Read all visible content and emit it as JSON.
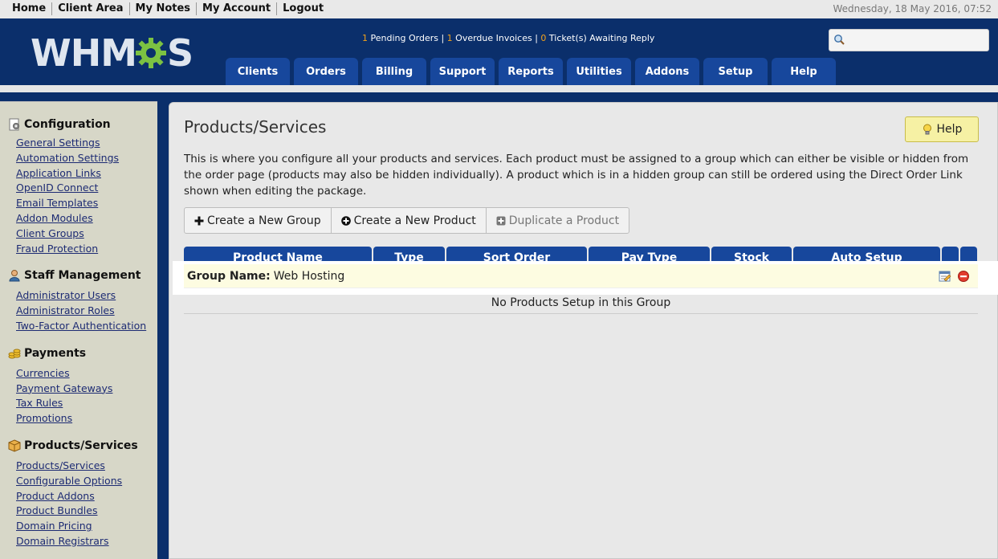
{
  "topbar": {
    "links": [
      "Home",
      "Client Area",
      "My Notes",
      "My Account",
      "Logout"
    ],
    "datetime": "Wednesday, 18 May 2016, 07:52"
  },
  "header": {
    "logo_left": "WHM",
    "logo_right": "S",
    "notices": {
      "pending_count": "1",
      "pending_label": "Pending Orders |",
      "overdue_count": "1",
      "overdue_label": "Overdue Invoices |",
      "tickets_count": "0",
      "tickets_label": "Ticket(s) Awaiting Reply"
    },
    "search_placeholder": "",
    "tabs": [
      "Clients",
      "Orders",
      "Billing",
      "Support",
      "Reports",
      "Utilities",
      "Addons",
      "Setup",
      "Help"
    ]
  },
  "sidebar": {
    "sections": [
      {
        "title": "Configuration",
        "icon": "configuration-icon",
        "items": [
          "General Settings",
          "Automation Settings",
          "Application Links",
          "OpenID Connect",
          "Email Templates",
          "Addon Modules",
          "Client Groups",
          "Fraud Protection"
        ]
      },
      {
        "title": "Staff Management",
        "icon": "staff-icon",
        "items": [
          "Administrator Users",
          "Administrator Roles",
          "Two-Factor Authentication"
        ]
      },
      {
        "title": "Payments",
        "icon": "payments-icon",
        "items": [
          "Currencies",
          "Payment Gateways",
          "Tax Rules",
          "Promotions"
        ]
      },
      {
        "title": "Products/Services",
        "icon": "box-icon",
        "items": [
          "Products/Services",
          "Configurable Options",
          "Product Addons",
          "Product Bundles",
          "Domain Pricing",
          "Domain Registrars"
        ]
      }
    ]
  },
  "main": {
    "title": "Products/Services",
    "help_label": "Help",
    "description": "This is where you configure all your products and services. Each product must be assigned to a group which can either be visible or hidden from the order page (products may also be hidden individually). A product which is in a hidden group can still be ordered using the Direct Order Link shown when editing the package.",
    "buttons": {
      "create_group": "Create a New Group",
      "create_product": "Create a New Product",
      "duplicate_product": "Duplicate a Product"
    },
    "table": {
      "columns": [
        "Product Name",
        "Type",
        "Sort Order",
        "Pay Type",
        "Stock",
        "Auto Setup",
        "",
        ""
      ],
      "group_label": "Group Name:",
      "group_name": "Web Hosting",
      "empty_message": "No Products Setup in this Group"
    }
  },
  "colors": {
    "navy": "#0b2f6b",
    "tab_blue": "#17479c",
    "accent_orange": "#f2a21b",
    "help_yellow": "#f6f1a4",
    "gear_green": "#7cc242"
  }
}
